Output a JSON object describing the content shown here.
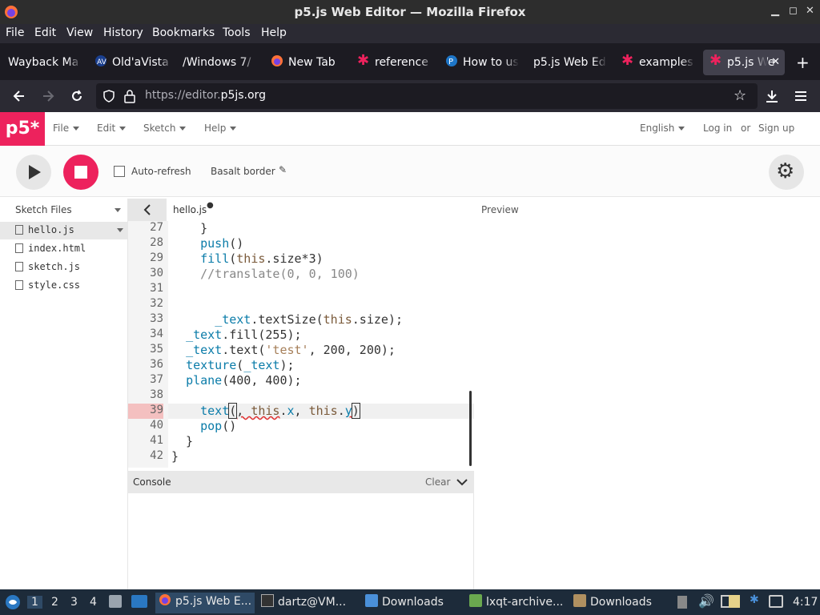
{
  "window": {
    "title": "p5.js Web Editor — Mozilla Firefox"
  },
  "menubar": [
    "File",
    "Edit",
    "View",
    "History",
    "Bookmarks",
    "Tools",
    "Help"
  ],
  "tabs": [
    {
      "label": "Wayback Ma"
    },
    {
      "label": "Old'aVista"
    },
    {
      "label": "/Windows 7/"
    },
    {
      "label": "New Tab"
    },
    {
      "label": "reference"
    },
    {
      "label": "How to us"
    },
    {
      "label": "p5.js Web Ed"
    },
    {
      "label": "examples"
    },
    {
      "label": "p5.js We"
    }
  ],
  "url": {
    "prefix": "https://editor.",
    "domain": "p5js.org"
  },
  "p5": {
    "logo": "p5*",
    "menus": [
      "File",
      "Edit",
      "Sketch",
      "Help"
    ],
    "language": "English",
    "login": "Log in",
    "or": "or",
    "signup": "Sign up",
    "autorefresh": "Auto-refresh",
    "sketchname": "Basalt border",
    "sketchfiles": "Sketch Files",
    "files": [
      "hello.js",
      "index.html",
      "sketch.js",
      "style.css"
    ],
    "current_file": "hello.js",
    "preview": "Preview",
    "console": "Console",
    "clear": "Clear"
  },
  "code": {
    "lines": [
      "27",
      "28",
      "29",
      "30",
      "31",
      "32",
      "33",
      "34",
      "35",
      "36",
      "37",
      "38",
      "39",
      "40",
      "41",
      "42"
    ],
    "highlighted_line": "39"
  },
  "taskbar": {
    "workspaces": [
      "1",
      "2",
      "3",
      "4"
    ],
    "apps": [
      "p5.js Web E...",
      "dartz@VM...",
      "Downloads",
      "lxqt-archive...",
      "Downloads"
    ],
    "clock": "4:17"
  },
  "colors": {
    "p5_pink": "#ed225d",
    "firefox_dark": "#1c1b22"
  }
}
